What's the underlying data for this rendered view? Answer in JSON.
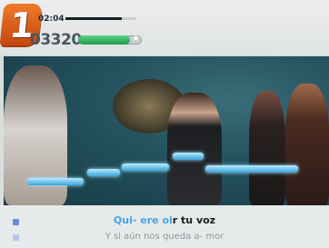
{
  "hud": {
    "player_number": "1",
    "time": "02:04",
    "song_progress": 0.8,
    "score": "03320",
    "performance_meter": 0.82,
    "star_icon": "star-icon"
  },
  "lyrics": {
    "current_sung": "Qui- ere oi",
    "current_unsung": "r tu voz",
    "next_line": "Y si aún nos queda a- mor"
  },
  "colors": {
    "badge": "#e8621e",
    "meter": "#2fb463",
    "sung_text": "#46a5e6",
    "note_bar": "#5ab8e8"
  }
}
